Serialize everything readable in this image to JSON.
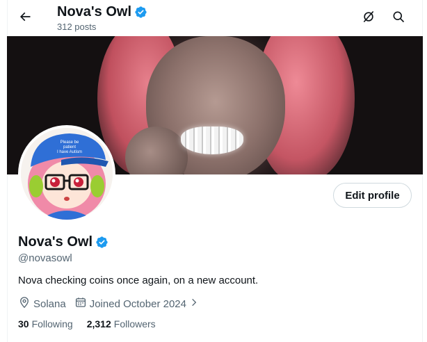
{
  "header": {
    "title": "Nova's Owl",
    "posts_count": "312 posts"
  },
  "profile": {
    "display_name": "Nova's Owl",
    "handle": "@novasowl",
    "bio": "Nova checking coins once again, on a new account.",
    "location": "Solana",
    "joined": "Joined October 2024",
    "following_count": "30",
    "following_label": "Following",
    "followers_count": "2,312",
    "followers_label": "Followers",
    "avatar_cap_text": "Please be patient I have Autism"
  },
  "actions": {
    "edit_profile_label": "Edit profile"
  },
  "icons": {
    "back": "arrow-left-icon",
    "grok": "grok-icon",
    "search": "search-icon",
    "verified": "verified-badge-icon",
    "location": "location-pin-icon",
    "calendar": "calendar-icon",
    "chevron": "chevron-right-icon"
  },
  "colors": {
    "verified_blue": "#1d9bf0",
    "text_primary": "#0f1419",
    "text_secondary": "#536471",
    "border": "#cfd9de"
  }
}
